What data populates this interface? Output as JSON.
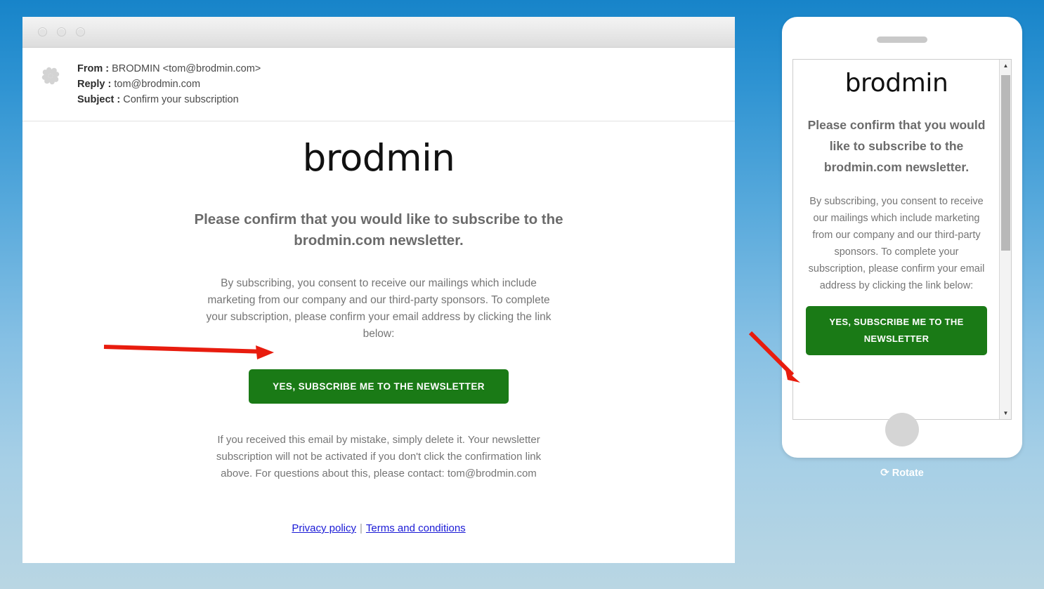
{
  "window": {
    "traffic_lights": [
      "close",
      "minimize",
      "maximize"
    ]
  },
  "email_header": {
    "from_label": "From :",
    "from_value": "BRODMIN <tom@brodmin.com>",
    "reply_label": "Reply :",
    "reply_value": "tom@brodmin.com",
    "subject_label": "Subject :",
    "subject_value": "Confirm your subscription",
    "avatar_icon": "pinwheel-identicon"
  },
  "email_body": {
    "logo": "brodmin",
    "headline": "Please confirm that you would like to subscribe to the brodmin.com newsletter.",
    "paragraph": "By subscribing, you consent to receive our mailings which include marketing from our company and our third-party sponsors. To complete your subscription, please confirm your email address by clicking the link below:",
    "cta_label": "YES, SUBSCRIBE ME TO THE NEWSLETTER",
    "disclaimer": "If you received this email by mistake, simply delete it. Your newsletter subscription will not be activated if you don't click the confirmation link above. For questions about this, please contact: tom@brodmin.com",
    "privacy_link": "Privacy policy",
    "link_separator": "|",
    "terms_link": "Terms and conditions"
  },
  "mobile_preview": {
    "logo": "brodmin",
    "headline": "Please confirm that you would like to subscribe to the brodmin.com newsletter.",
    "paragraph": "By subscribing, you consent to receive our mailings which include marketing from our company and our third-party sponsors. To complete your subscription, please confirm your email address by clicking the link below:",
    "cta_label": "YES, SUBSCRIBE ME TO THE NEWSLETTER",
    "scroll_up_arrow": "▲",
    "scroll_down_arrow": "▼",
    "rotate_label": "Rotate",
    "rotate_icon": "⟳"
  },
  "colors": {
    "cta_green": "#1a7a16",
    "link_blue": "#1a1ad6",
    "annotation_red": "#e81c0e",
    "background_top": "#1784c9",
    "background_bottom": "#b9d6e3",
    "heading_gray": "#6b6b6b",
    "body_gray": "#757575"
  },
  "annotations": [
    {
      "name": "arrow-to-desktop-cta",
      "direction": "right"
    },
    {
      "name": "arrow-to-mobile-cta",
      "direction": "down-right"
    }
  ]
}
